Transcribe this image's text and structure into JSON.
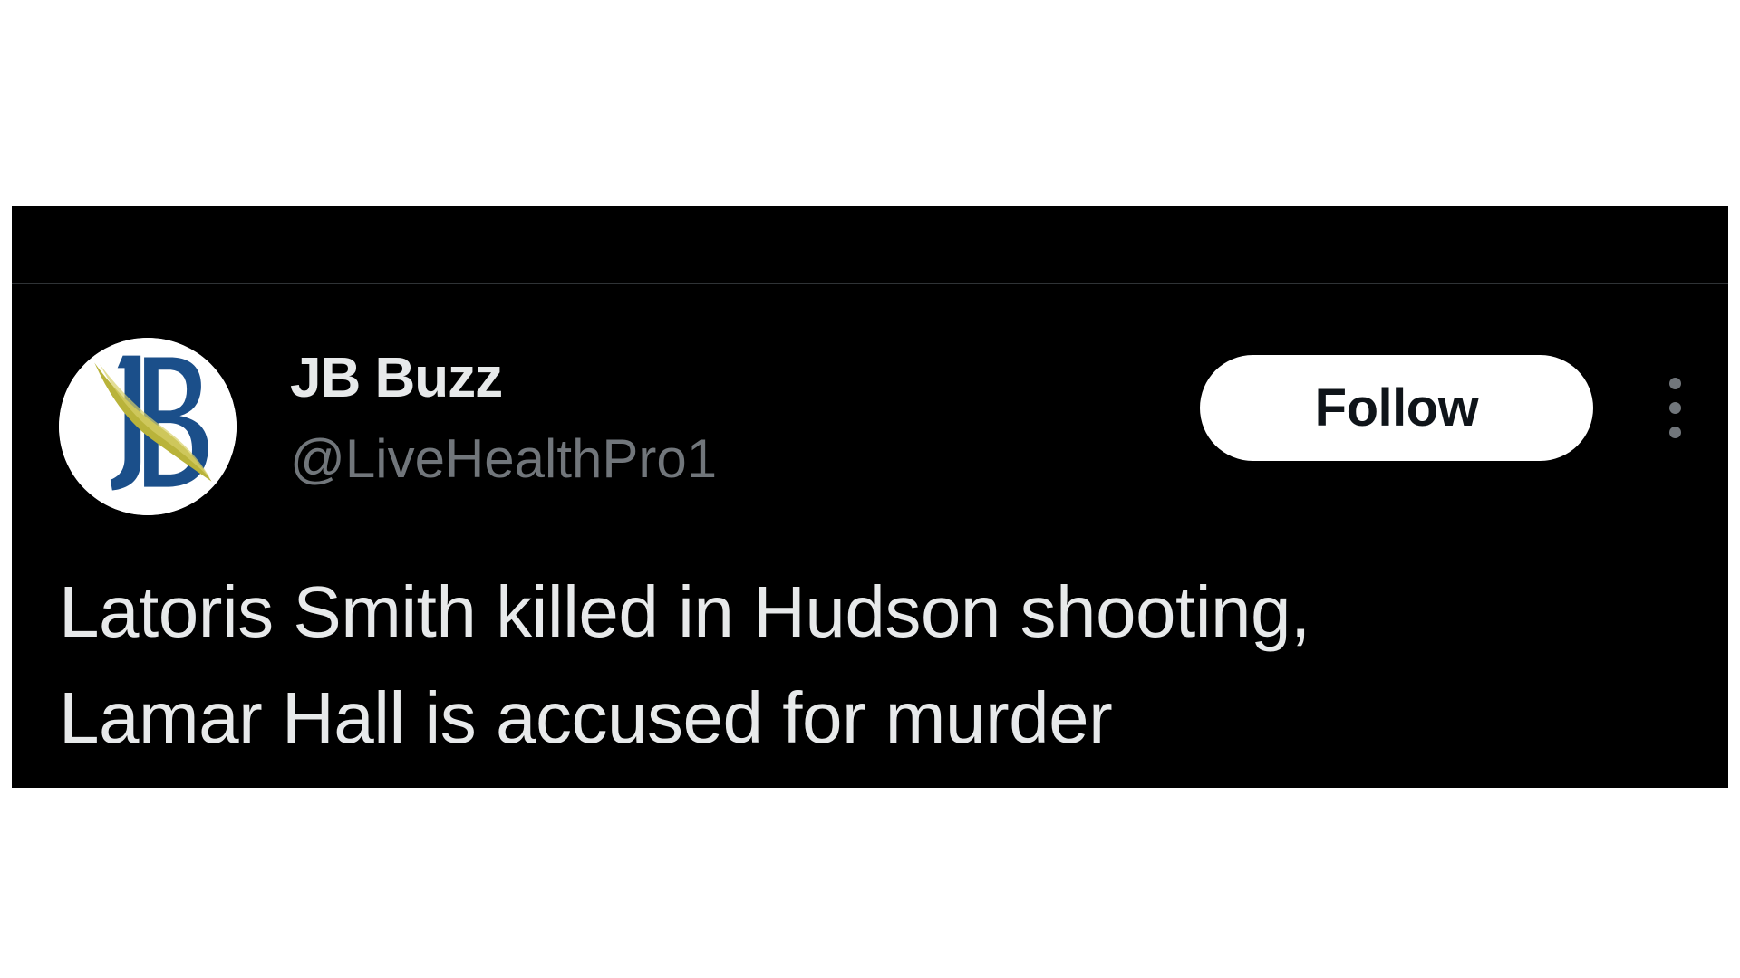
{
  "tweet": {
    "author": {
      "display_name": "JB Buzz",
      "handle": "@LiveHealthPro1",
      "avatar_icon": "jb-logo-icon",
      "avatar_logo_text": "JB"
    },
    "follow_label": "Follow",
    "more_icon": "more-vertical-icon",
    "text_lines": [
      "Latoris Smith killed in Hudson shooting,",
      "Lamar Hall is accused for murder"
    ]
  },
  "colors": {
    "card_background": "#000000",
    "page_background": "#ffffff",
    "primary_text": "#e7e9ea",
    "secondary_text": "#71767b",
    "follow_button_bg": "#ffffff",
    "follow_button_text": "#0f1419",
    "logo_blue": "#1b4f8a",
    "logo_gold": "#b9b33a"
  }
}
